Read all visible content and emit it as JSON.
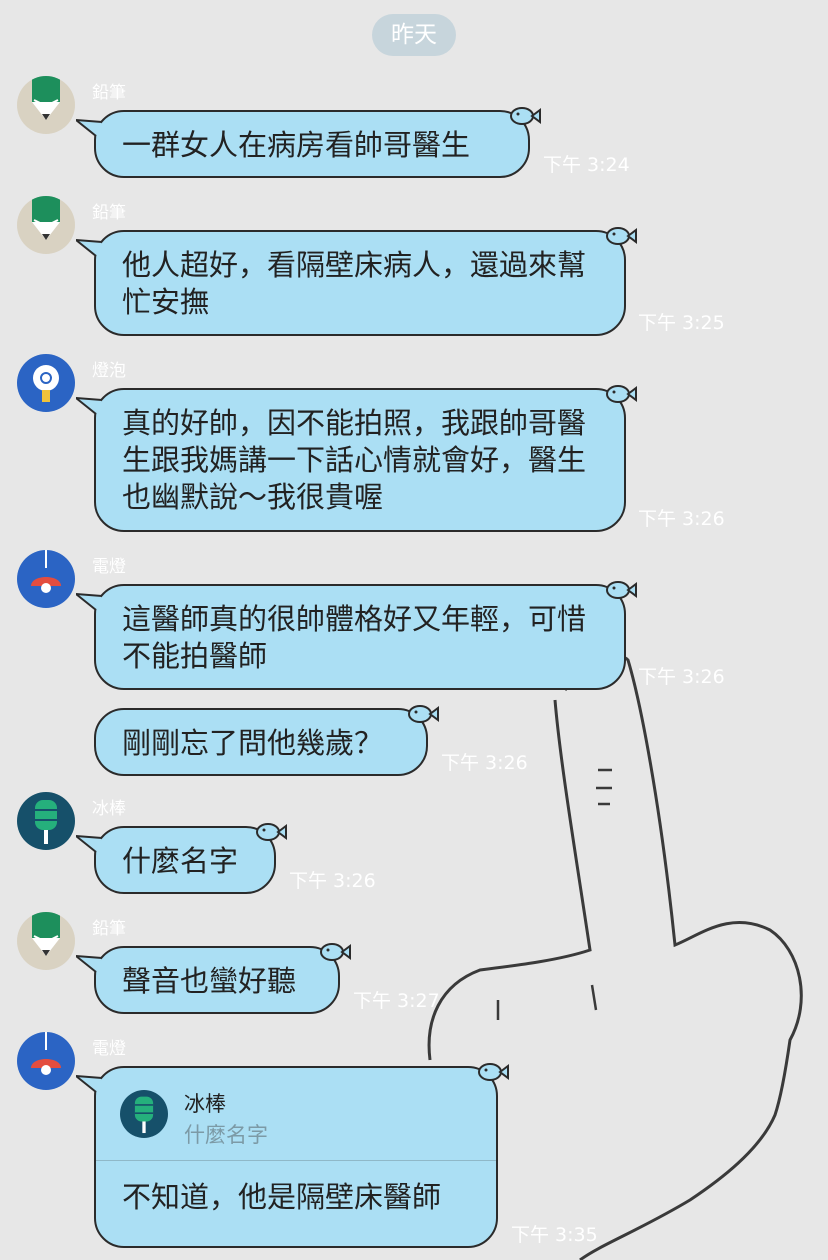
{
  "date_divider": "昨天",
  "messages": [
    {
      "sender": "鉛筆",
      "text": "一群女人在病房看帥哥醫生",
      "time": "下午 3:24"
    },
    {
      "sender": "鉛筆",
      "text": "他人超好，看隔壁床病人，還過來幫忙安撫",
      "time": "下午 3:25"
    },
    {
      "sender": "燈泡",
      "text": "真的好帥，因不能拍照，我跟帥哥醫生跟我媽講一下話心情就會好，醫生也幽默說～我很貴喔",
      "time": "下午 3:26"
    },
    {
      "sender": "電燈",
      "text": "這醫師真的很帥體格好又年輕，可惜不能拍醫師",
      "time": "下午 3:26"
    },
    {
      "text": "剛剛忘了問他幾歲？",
      "time": "下午 3:26"
    },
    {
      "sender": "冰棒",
      "text": "什麼名字",
      "time": "下午 3:26"
    },
    {
      "sender": "鉛筆",
      "text": "聲音也蠻好聽",
      "time": "下午 3:27"
    },
    {
      "sender": "電燈",
      "reply_to": {
        "name": "冰棒",
        "text": "什麼名字"
      },
      "text": "不知道，他是隔壁床醫師",
      "time": "下午 3:35"
    }
  ],
  "icons": {
    "pencil": "pencil-avatar-icon",
    "bulb": "lightbulb-avatar-icon",
    "lamp": "lamp-avatar-icon",
    "popsicle": "popsicle-avatar-icon",
    "fish": "fish-sticker-icon"
  },
  "colors": {
    "background": "#e7e7e7",
    "bubble": "#abdff4",
    "bubble_border": "#2b2b2b",
    "date_pill": "#c7d5dc",
    "pencil_avatar_bg": "#d9d2c2",
    "pencil_green": "#1d8f5c",
    "bulb_avatar_bg": "#2b64c4",
    "lamp_avatar_bg": "#2b64c4",
    "lamp_red": "#e34d3f",
    "popsicle_avatar_bg": "#16506a",
    "popsicle_green": "#25b07c"
  }
}
